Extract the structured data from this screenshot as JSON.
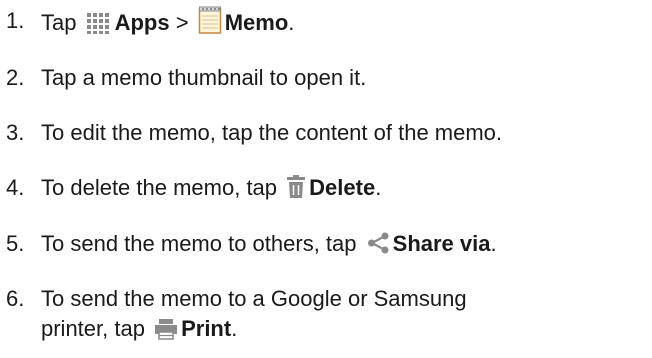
{
  "steps": [
    {
      "number": "1.",
      "text_before": "Tap",
      "icon1": "apps-grid-icon",
      "bold1": "Apps",
      "sep": ">",
      "icon2": "memo-notepad-icon",
      "bold2": "Memo",
      "text_after": "."
    },
    {
      "number": "2.",
      "text": "Tap a memo thumbnail to open it."
    },
    {
      "number": "3.",
      "text": "To edit the memo, tap the content of the memo."
    },
    {
      "number": "4.",
      "text_before": "To delete the memo, tap",
      "icon": "trash-icon",
      "bold": "Delete",
      "text_after": "."
    },
    {
      "number": "5.",
      "text_before": "To send the memo to others, tap",
      "icon": "share-icon",
      "bold": "Share via",
      "text_after": "."
    },
    {
      "number": "6.",
      "line1": "To send the memo to a Google or Samsung",
      "line2_before": "printer, tap",
      "icon": "printer-icon",
      "bold": "Print",
      "text_after": "."
    }
  ],
  "colors": {
    "text": "#1a1a1a",
    "icon_gray": "#8a8a8a",
    "memo_paper": "#fff6dc",
    "memo_border": "#c08a3e"
  }
}
